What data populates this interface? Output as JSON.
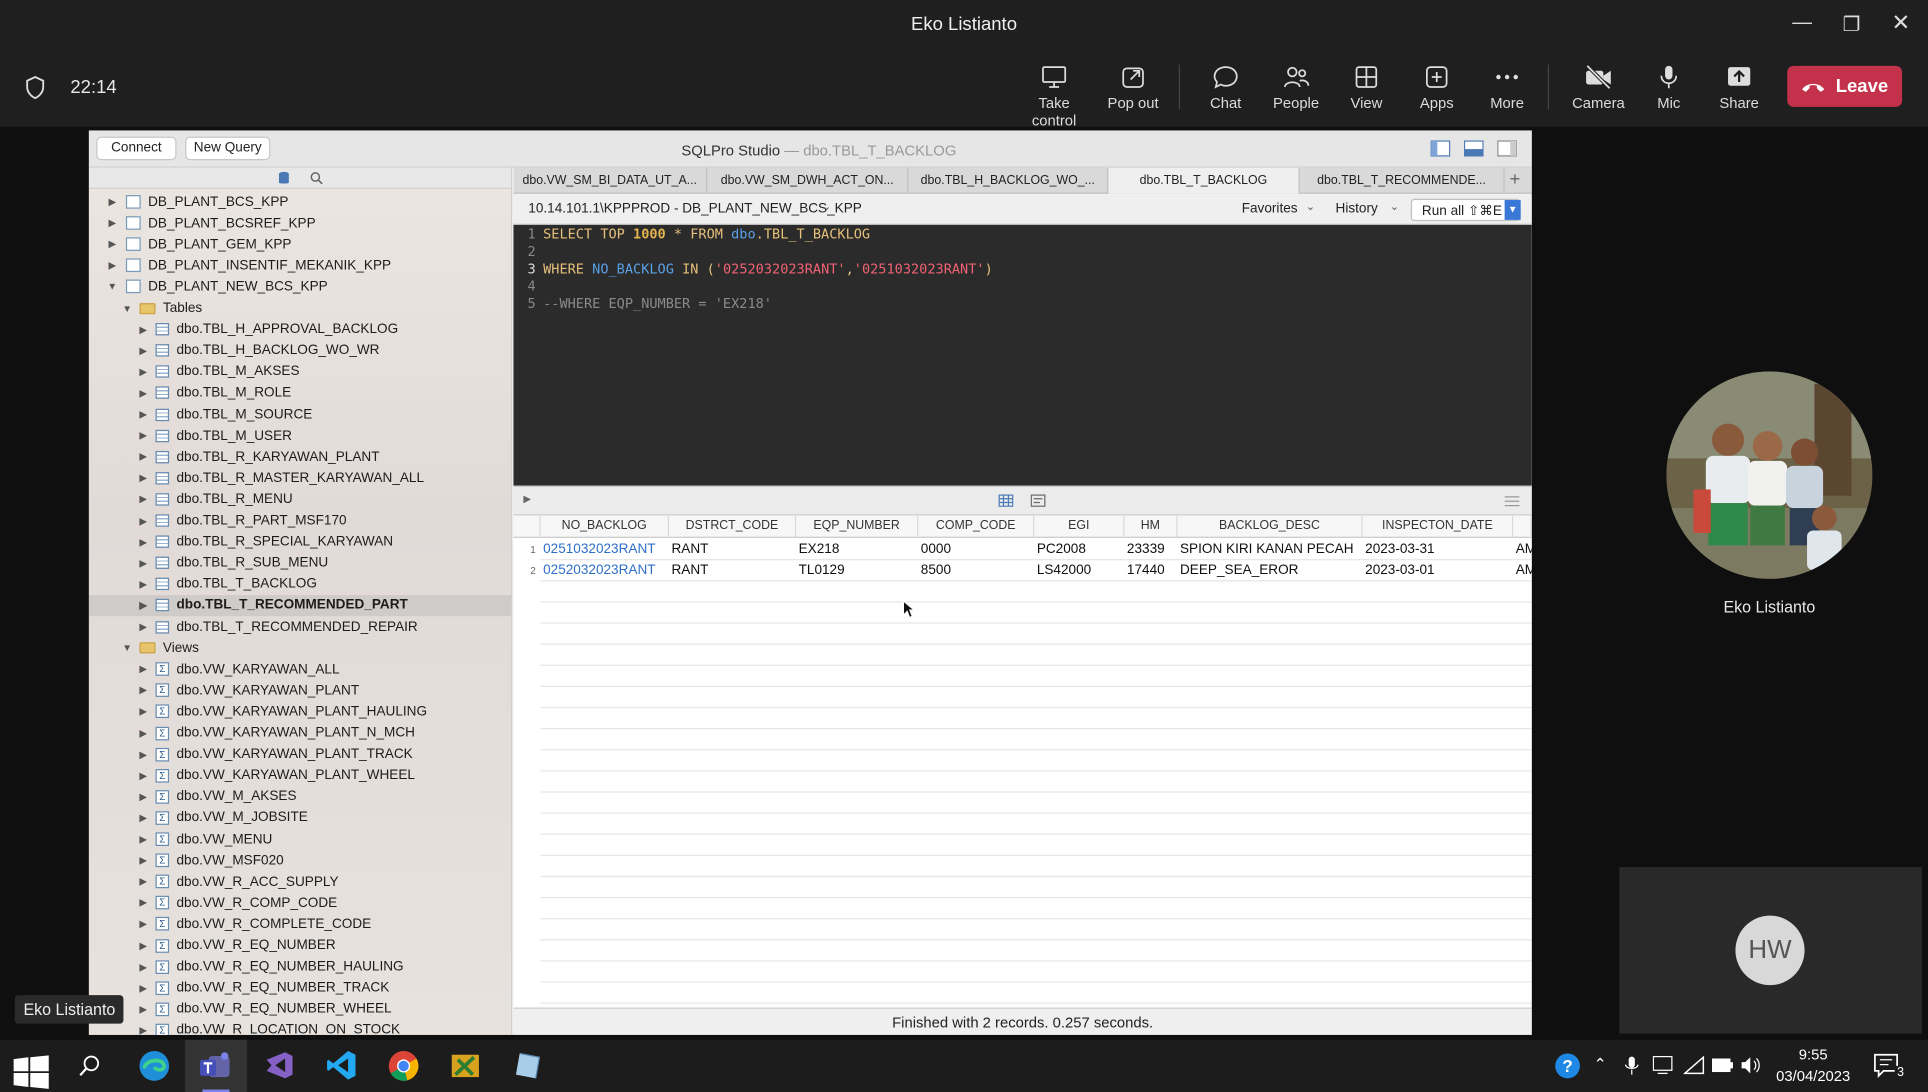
{
  "window": {
    "title": "Eko Listianto"
  },
  "meeting": {
    "time": "22:14",
    "buttons": [
      {
        "label": "Take control",
        "icon": "take-control-icon"
      },
      {
        "label": "Pop out",
        "icon": "pop-out-icon"
      },
      {
        "label": "Chat",
        "icon": "chat-icon"
      },
      {
        "label": "People",
        "icon": "people-icon"
      },
      {
        "label": "View",
        "icon": "view-icon"
      },
      {
        "label": "Apps",
        "icon": "apps-icon"
      },
      {
        "label": "More",
        "icon": "more-icon"
      },
      {
        "label": "Camera",
        "icon": "camera-off-icon"
      },
      {
        "label": "Mic",
        "icon": "mic-icon"
      },
      {
        "label": "Share",
        "icon": "share-icon"
      }
    ],
    "leave_label": "Leave",
    "leave_color": "#c4314b"
  },
  "sqlpro": {
    "connect_label": "Connect",
    "new_query_label": "New Query",
    "app_name": "SQLPro Studio",
    "title_sep": "—",
    "title_table": "dbo.TBL_T_BACKLOG",
    "tabs": [
      "dbo.VW_SM_BI_DATA_UT_A...",
      "dbo.VW_SM_DWH_ACT_ON...",
      "dbo.TBL_H_BACKLOG_WO_...",
      "dbo.TBL_T_BACKLOG",
      "dbo.TBL_T_RECOMMENDE..."
    ],
    "active_tab": 3,
    "connection": "10.14.101.1\\KPPPROD - DB_PLANT_NEW_BCS_KPP",
    "favorites_label": "Favorites",
    "history_label": "History",
    "run_label": "Run all ⇧⌘E",
    "databases": [
      "DB_PLANT_BCS_KPP",
      "DB_PLANT_BCSREF_KPP",
      "DB_PLANT_GEM_KPP",
      "DB_PLANT_INSENTIF_MEKANIK_KPP",
      "DB_PLANT_NEW_BCS_KPP"
    ],
    "tables_label": "Tables",
    "tables": [
      "dbo.TBL_H_APPROVAL_BACKLOG",
      "dbo.TBL_H_BACKLOG_WO_WR",
      "dbo.TBL_M_AKSES",
      "dbo.TBL_M_ROLE",
      "dbo.TBL_M_SOURCE",
      "dbo.TBL_M_USER",
      "dbo.TBL_R_KARYAWAN_PLANT",
      "dbo.TBL_R_MASTER_KARYAWAN_ALL",
      "dbo.TBL_R_MENU",
      "dbo.TBL_R_PART_MSF170",
      "dbo.TBL_R_SPECIAL_KARYAWAN",
      "dbo.TBL_R_SUB_MENU",
      "dbo.TBL_T_BACKLOG",
      "dbo.TBL_T_RECOMMENDED_PART",
      "dbo.TBL_T_RECOMMENDED_REPAIR"
    ],
    "selected_table": 13,
    "views_label": "Views",
    "views": [
      "dbo.VW_KARYAWAN_ALL",
      "dbo.VW_KARYAWAN_PLANT",
      "dbo.VW_KARYAWAN_PLANT_HAULING",
      "dbo.VW_KARYAWAN_PLANT_N_MCH",
      "dbo.VW_KARYAWAN_PLANT_TRACK",
      "dbo.VW_KARYAWAN_PLANT_WHEEL",
      "dbo.VW_M_AKSES",
      "dbo.VW_M_JOBSITE",
      "dbo.VW_MENU",
      "dbo.VW_MSF020",
      "dbo.VW_R_ACC_SUPPLY",
      "dbo.VW_R_COMP_CODE",
      "dbo.VW_R_COMPLETE_CODE",
      "dbo.VW_R_EQ_NUMBER",
      "dbo.VW_R_EQ_NUMBER_HAULING",
      "dbo.VW_R_EQ_NUMBER_TRACK",
      "dbo.VW_R_EQ_NUMBER_WHEEL",
      "dbo.VW_R_LOCATION_ON_STOCK"
    ],
    "editor": {
      "l1a": "SELECT TOP ",
      "l1b": "1000",
      "l1c": " * FROM ",
      "l1d": "dbo",
      ".": ".",
      "l1e": ".TBL_T_BACKLOG",
      "l3a": "WHERE ",
      "l3b": "NO_BACKLOG",
      "l3c": " IN (",
      "l3d": "'0252032023RANT'",
      "l3e": ",",
      "l3f": "'0251032023RANT'",
      "l3g": ")",
      "l5": "--WHERE EQP_NUMBER = 'EX218'"
    },
    "columns": [
      "NO_BACKLOG",
      "DSTRCT_CODE",
      "EQP_NUMBER",
      "COMP_CODE",
      "EGI",
      "HM",
      "BACKLOG_DESC",
      "INSPECTON_DATE"
    ],
    "rows": [
      [
        "0251032023RANT",
        "RANT",
        "EX218",
        "0000",
        "PC2008",
        "23339",
        "SPION KIRI KANAN PECAH",
        "2023-03-31",
        "AM"
      ],
      [
        "0252032023RANT",
        "RANT",
        "TL0129",
        "8500",
        "LS42000",
        "17440",
        "DEEP_SEA_EROR",
        "2023-03-01",
        "AM"
      ]
    ],
    "status": "Finished with 2 records. 0.257 seconds."
  },
  "participants": {
    "main_name": "Eko Listianto",
    "hw_initials": "HW",
    "chip_name": "Eko Listianto"
  },
  "taskbar": {
    "time": "9:55",
    "date": "03/04/2023",
    "notif_count": "3"
  }
}
